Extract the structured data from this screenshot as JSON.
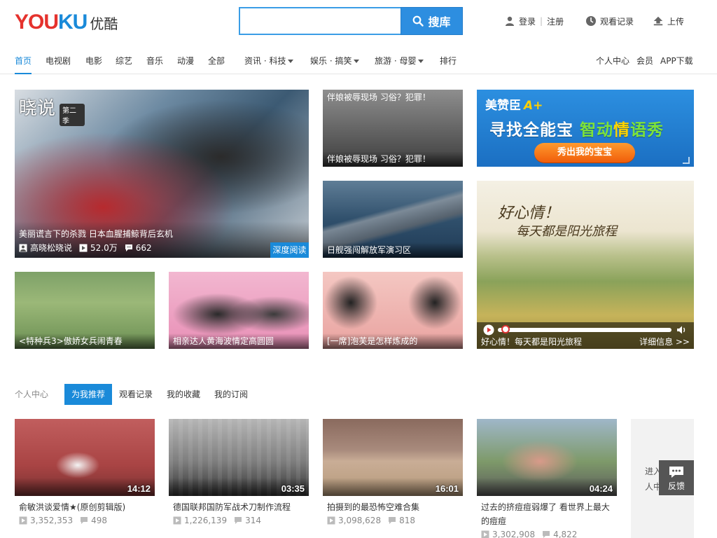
{
  "header": {
    "logo_en_a": "YOU",
    "logo_en_b": "KU",
    "logo_cn": "优酷",
    "search": {
      "value": "",
      "placeholder": "",
      "button_label": "搜库"
    },
    "login": "登录",
    "register": "注册",
    "sep": "|",
    "history": "观看记录",
    "upload": "上传"
  },
  "nav": {
    "items": [
      "首页",
      "电视剧",
      "电影",
      "综艺",
      "音乐",
      "动漫",
      "全部",
      "资讯 · 科技",
      "娱乐 · 搞笑",
      "旅游 · 母婴",
      "排行"
    ],
    "right": [
      "个人中心",
      "会员",
      "APP下载"
    ]
  },
  "feature": {
    "main": {
      "badge_a": "晓说",
      "badge_b": "第二季",
      "title": "美丽谎言下的杀戮 日本血腥捕鲸背后玄机",
      "author": "高晓松晓说",
      "plays": "52.0万",
      "comments": "662",
      "tag": "深度阅读"
    },
    "grid": [
      {
        "top": "伴娘被辱现场 习俗？犯罪！",
        "caption": "伴娘被辱现场 习俗？犯罪！"
      },
      {
        "caption": "日舰强闯解放军演习区"
      },
      {
        "caption": "<特种兵3>傲娇女兵闹青春"
      },
      {
        "caption": "相亲达人黄海波情定高圆圆"
      },
      {
        "caption": "[一席]泡芙是怎样炼成的"
      }
    ],
    "ad": {
      "brand": "美赞臣",
      "brand_mark": "A+",
      "slogan_a": "寻找全能宝",
      "slogan_b": "智动",
      "slogan_c": "情",
      "slogan_d": "语秀",
      "button": "秀出我的宝宝"
    },
    "player": {
      "hand_a": "好心情！",
      "hand_b": "每天都是阳光旅程",
      "title": "好心情！每天都是阳光旅程",
      "more": "详细信息 >>",
      "progress": 0.02
    }
  },
  "tabs": {
    "label": "个人中心",
    "items": [
      "为我推荐",
      "观看记录",
      "我的收藏",
      "我的订阅"
    ]
  },
  "videos": [
    {
      "duration": "14:12",
      "title": "俞敏洪谈爱情★(原创剪辑版)",
      "plays": "3,352,353",
      "comments": "498"
    },
    {
      "duration": "03:35",
      "title": "德国联邦国防军战术刀制作流程",
      "plays": "1,226,139",
      "comments": "314"
    },
    {
      "duration": "16:01",
      "title": "拍摄到的最恐怖空难合集",
      "plays": "3,098,628",
      "comments": "818"
    },
    {
      "duration": "04:24",
      "title": "过去的挤痘痘弱爆了 看世界上最大的痘痘",
      "plays": "3,302,908",
      "comments": "4,822"
    }
  ],
  "more_card": {
    "text": "进入个人中心"
  },
  "feedback": {
    "label": "反馈"
  },
  "colors": {
    "accent": "#1a8ad9",
    "logo_red": "#e5322d"
  }
}
